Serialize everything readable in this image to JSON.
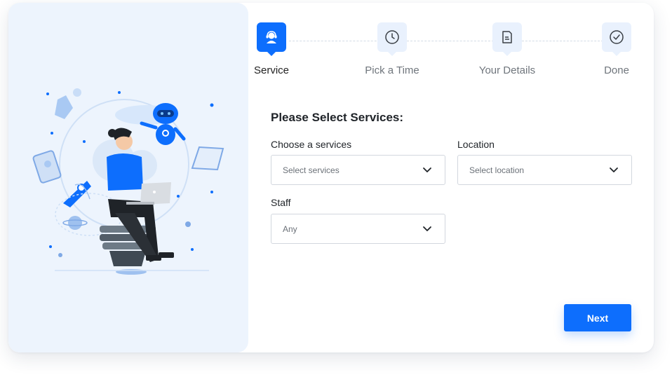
{
  "stepper": {
    "steps": [
      {
        "label": "Service",
        "icon": "support-agent-icon",
        "active": true
      },
      {
        "label": "Pick a Time",
        "icon": "clock-icon",
        "active": false
      },
      {
        "label": "Your Details",
        "icon": "document-icon",
        "active": false
      },
      {
        "label": "Done",
        "icon": "check-circle-icon",
        "active": false
      }
    ]
  },
  "form": {
    "title": "Please Select Services:",
    "services": {
      "label": "Choose a services",
      "value": "Select services"
    },
    "location": {
      "label": "Location",
      "value": "Select location"
    },
    "staff": {
      "label": "Staff",
      "value": "Any"
    },
    "next_label": "Next"
  },
  "colors": {
    "accent": "#0d6efd",
    "panel_bg": "#edf4fd",
    "step_bg": "#e9f1fd"
  }
}
